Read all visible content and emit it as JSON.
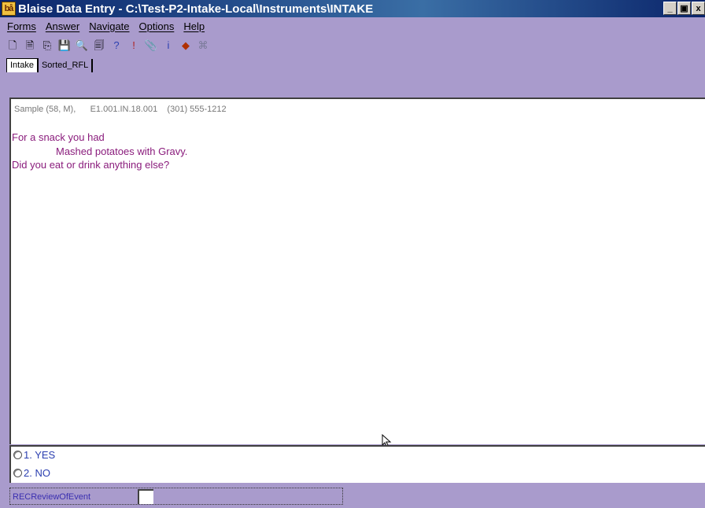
{
  "window": {
    "title": "Blaise Data Entry - C:\\Test-P2-Intake-Local\\Instruments\\INTAKE",
    "app_icon_text": "bå",
    "minimize": "_",
    "restore": "▣",
    "close": "x"
  },
  "menu": {
    "items": [
      "Forms",
      "Answer",
      "Navigate",
      "Options",
      "Help"
    ]
  },
  "toolbar": {
    "buttons": [
      {
        "icon": "new-form-icon",
        "glyph": "🗋"
      },
      {
        "icon": "open-form-icon",
        "glyph": "🗎"
      },
      {
        "icon": "copy-form-icon",
        "glyph": "⎘"
      },
      {
        "icon": "save-icon",
        "glyph": "💾"
      },
      {
        "icon": "find-icon",
        "glyph": "🔍"
      },
      {
        "icon": "print-preview-icon",
        "glyph": "🗐"
      },
      {
        "icon": "question-help-icon",
        "glyph": "?"
      },
      {
        "icon": "error-exclamation-icon",
        "glyph": "!"
      },
      {
        "icon": "remark-clip-icon",
        "glyph": "📎"
      },
      {
        "icon": "info-icon",
        "glyph": "i"
      },
      {
        "icon": "tag-icon",
        "glyph": "◆"
      },
      {
        "icon": "watch-icon",
        "glyph": "⌘"
      }
    ]
  },
  "tabs": [
    {
      "label": "Intake",
      "active": true
    },
    {
      "label": "Sorted_RFL",
      "active": false
    }
  ],
  "question": {
    "info_line": "Sample (58, M),      E1.001.IN.18.001    (301) 555-1212",
    "line1": "For a snack you had",
    "line2": "Mashed potatoes with Gravy.",
    "line3": "Did you eat or drink anything else?"
  },
  "answers": [
    {
      "label": "1.  YES"
    },
    {
      "label": "2.  NO"
    }
  ],
  "status": {
    "field_name": "RECReviewOfEvent",
    "field_value": ""
  },
  "colors": {
    "background": "#a99bcc",
    "question_text": "#8a1c7c",
    "answer_text": "#2b3fb0",
    "titlebar": "#0a246a"
  }
}
